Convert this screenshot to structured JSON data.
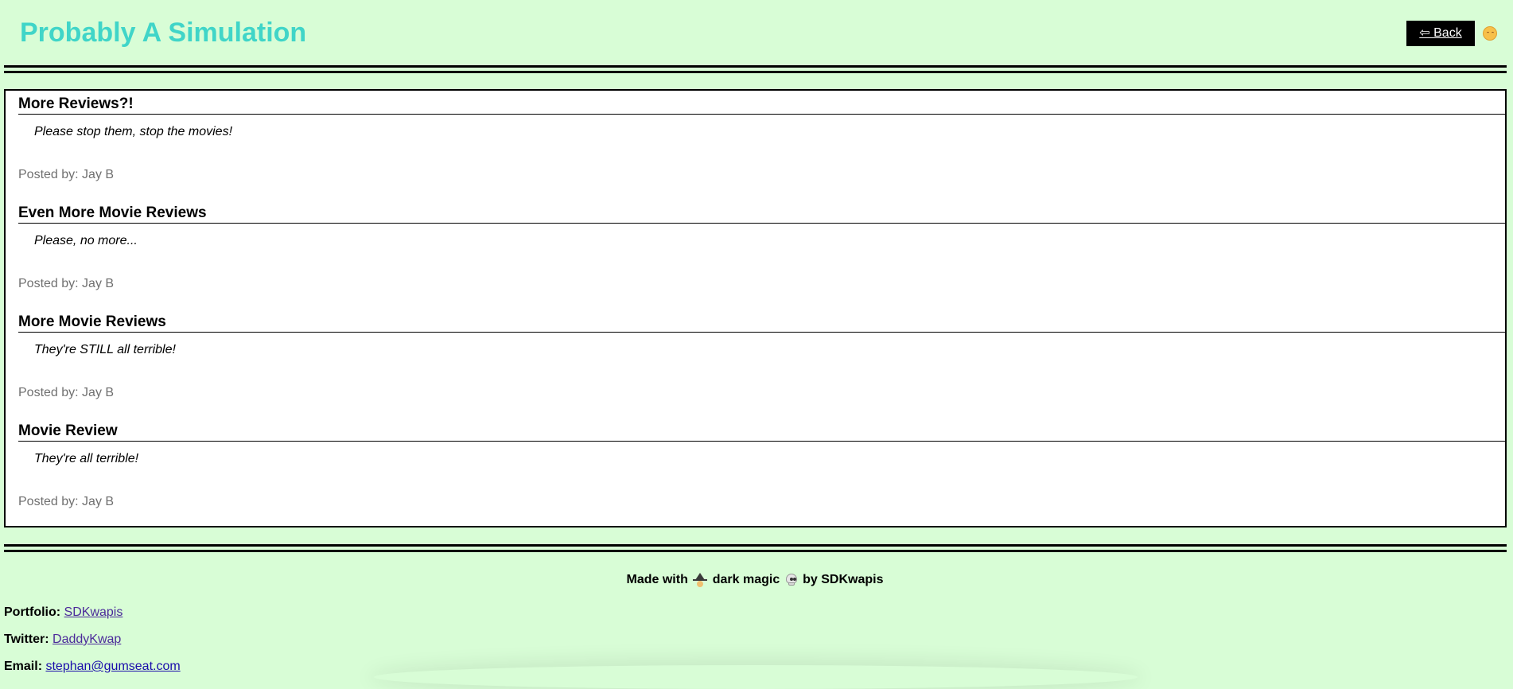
{
  "header": {
    "title": "Probably A Simulation",
    "back_label": "⇦ Back"
  },
  "posts": [
    {
      "title": "More Reviews?!",
      "body": "Please stop them, stop the movies!",
      "author": "Posted by: Jay B"
    },
    {
      "title": "Even More Movie Reviews",
      "body": "Please, no more...",
      "author": "Posted by: Jay B"
    },
    {
      "title": "More Movie Reviews",
      "body": "They're STILL all terrible!",
      "author": "Posted by: Jay B"
    },
    {
      "title": "Movie Review",
      "body": "They're all terrible!",
      "author": "Posted by: Jay B"
    }
  ],
  "footer": {
    "made_with": "Made with",
    "dark_magic": "dark magic",
    "by": "by SDKwapis",
    "portfolio_label": "Portfolio:",
    "portfolio_link": "SDKwapis",
    "twitter_label": "Twitter:",
    "twitter_link": "DaddyKwap",
    "email_label": "Email:",
    "email_link": "stephan@gumseat.com"
  },
  "colors": {
    "background": "#d8fdd6",
    "title": "#40d5c8",
    "author": "#707070"
  },
  "icons": {
    "theme_toggle": "sun-face-icon",
    "witch": "witch-icon",
    "skull": "skull-icon"
  }
}
